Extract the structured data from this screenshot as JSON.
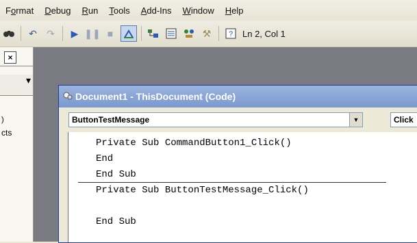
{
  "menu": {
    "items": [
      {
        "pre": "F",
        "ul": "o",
        "post": "rmat"
      },
      {
        "pre": "",
        "ul": "D",
        "post": "ebug"
      },
      {
        "pre": "",
        "ul": "R",
        "post": "un"
      },
      {
        "pre": "",
        "ul": "T",
        "post": "ools"
      },
      {
        "pre": "",
        "ul": "A",
        "post": "dd-Ins"
      },
      {
        "pre": "",
        "ul": "W",
        "post": "indow"
      },
      {
        "pre": "",
        "ul": "H",
        "post": "elp"
      }
    ]
  },
  "toolbar": {
    "status": "Ln 2, Col 1"
  },
  "left_panel": {
    "close_glyph": "×",
    "text1": ")",
    "text2": "cts"
  },
  "code_window": {
    "title": "Document1 - ThisDocument (Code)",
    "object_combo": "ButtonTestMessage",
    "proc_combo": "Click",
    "lines": [
      "Private Sub CommandButton1_Click()",
      "End",
      "End Sub",
      "Private Sub ButtonTestMessage_Click()",
      "",
      "End Sub"
    ]
  }
}
